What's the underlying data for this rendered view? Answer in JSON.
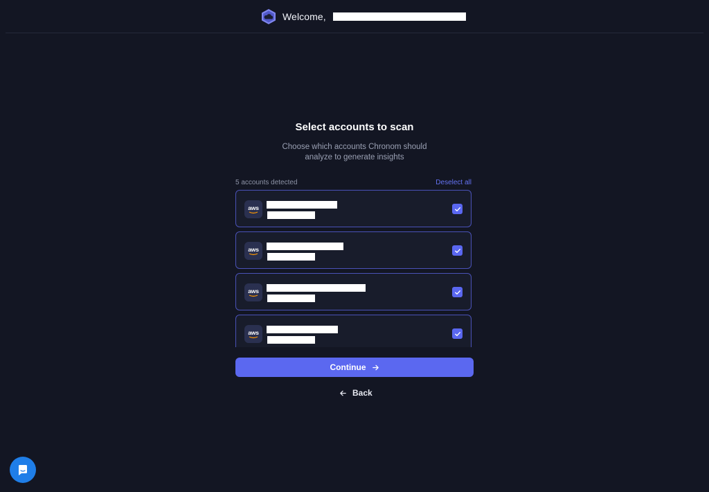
{
  "header": {
    "welcome_label": "Welcome,",
    "logo_icon": "chronom-logo-icon"
  },
  "main": {
    "title": "Select accounts to scan",
    "subtitle": "Choose which accounts Chronom should analyze to generate insights",
    "detected_count": "5 accounts detected",
    "deselect_all": "Deselect all"
  },
  "accounts": [
    {
      "provider_label": "aws",
      "selected": true
    },
    {
      "provider_label": "aws",
      "selected": true
    },
    {
      "provider_label": "aws",
      "selected": true
    },
    {
      "provider_label": "aws",
      "selected": true
    }
  ],
  "actions": {
    "continue_label": "Continue",
    "back_label": "Back"
  },
  "colors": {
    "background": "#131623",
    "accent": "#5b68f0",
    "card_border": "#4a52b8",
    "link": "#6472f2",
    "chat_launcher": "#1f7ee8"
  },
  "icons": {
    "continue": "arrow-right-icon",
    "back": "arrow-left-icon",
    "checkbox": "check-icon",
    "chat": "chat-bubble-icon"
  }
}
